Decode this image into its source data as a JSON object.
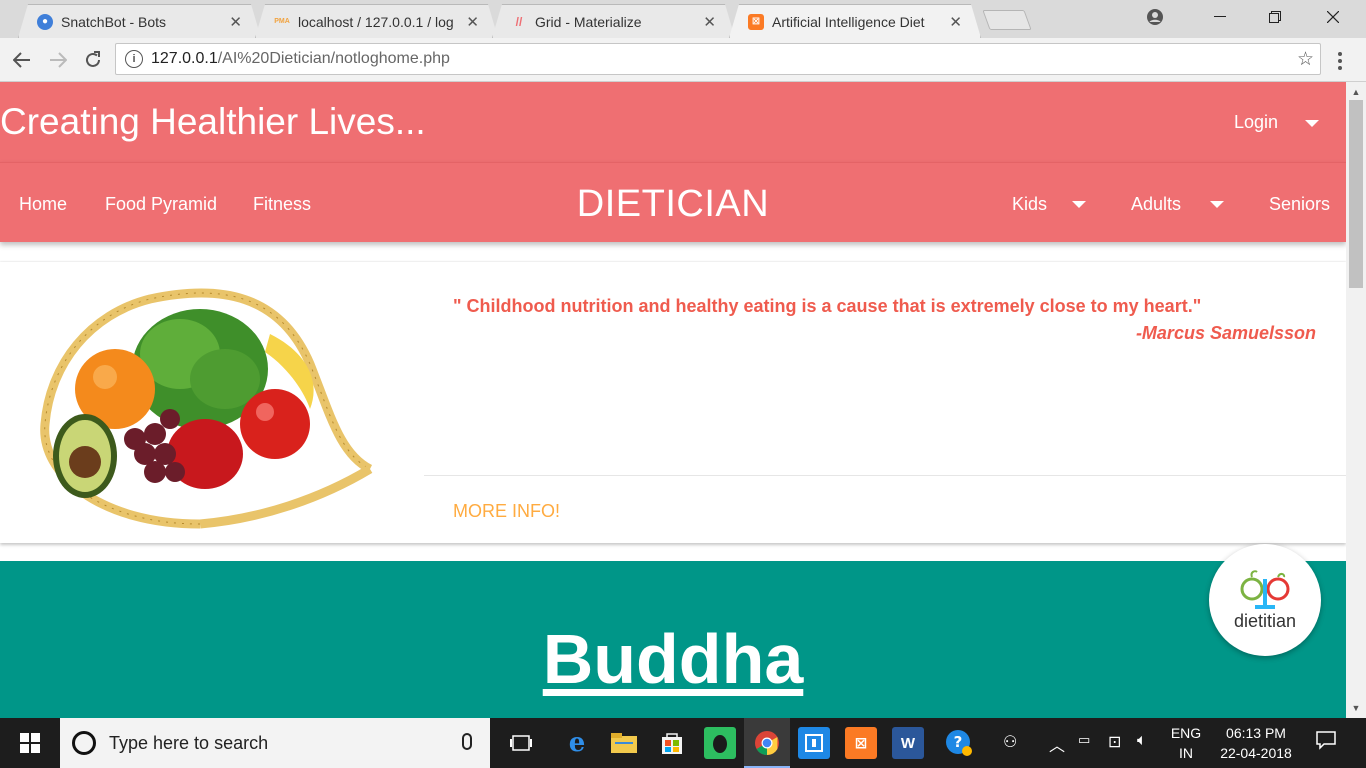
{
  "browser": {
    "tabs": [
      {
        "title": "SnatchBot - Bots",
        "favicon_color": "#3f7fd9",
        "favicon_glyph": "●"
      },
      {
        "title": "localhost / 127.0.0.1 / log",
        "favicon_color": "#f1a340",
        "favicon_glyph": "PMA"
      },
      {
        "title": "Grid - Materialize",
        "favicon_color": "#ee6e73",
        "favicon_glyph": "//"
      },
      {
        "title": "Artificial Intelligence Diet",
        "favicon_color": "#fb7a24",
        "favicon_glyph": "⊠"
      }
    ],
    "active_tab_index": 3,
    "url_host": "127.0.0.1",
    "url_path": "/AI%20Dietician/notloghome.php"
  },
  "header": {
    "tagline": "Creating Healthier Lives...",
    "login_label": "Login"
  },
  "nav": {
    "brand": "DIETICIAN",
    "left_links": [
      "Home",
      "Food Pyramid",
      "Fitness"
    ],
    "right_links": [
      {
        "label": "Kids",
        "has_dropdown": true
      },
      {
        "label": "Adults",
        "has_dropdown": true
      },
      {
        "label": "Seniors",
        "has_dropdown": false
      }
    ]
  },
  "card": {
    "image_icon": "vegetables-heart-tape-image",
    "quote": "\" Childhood nutrition and healthy eating is a cause that is extremely close to my heart.\"",
    "author": "-Marcus Samuelsson",
    "action_label": "MORE INFO!"
  },
  "hero": {
    "heading": "Buddha"
  },
  "logo_badge": {
    "text": "dietitian",
    "icon": "apple-scale-logo-icon"
  },
  "taskbar": {
    "search_placeholder": "Type here to search",
    "language_line1": "ENG",
    "language_line2": "IN",
    "time": "06:13 PM",
    "date": "22-04-2018"
  },
  "colors": {
    "primary": "#ef6f72",
    "quote_text": "#ef5b4e",
    "action": "#ffab40",
    "hero": "#009688"
  }
}
